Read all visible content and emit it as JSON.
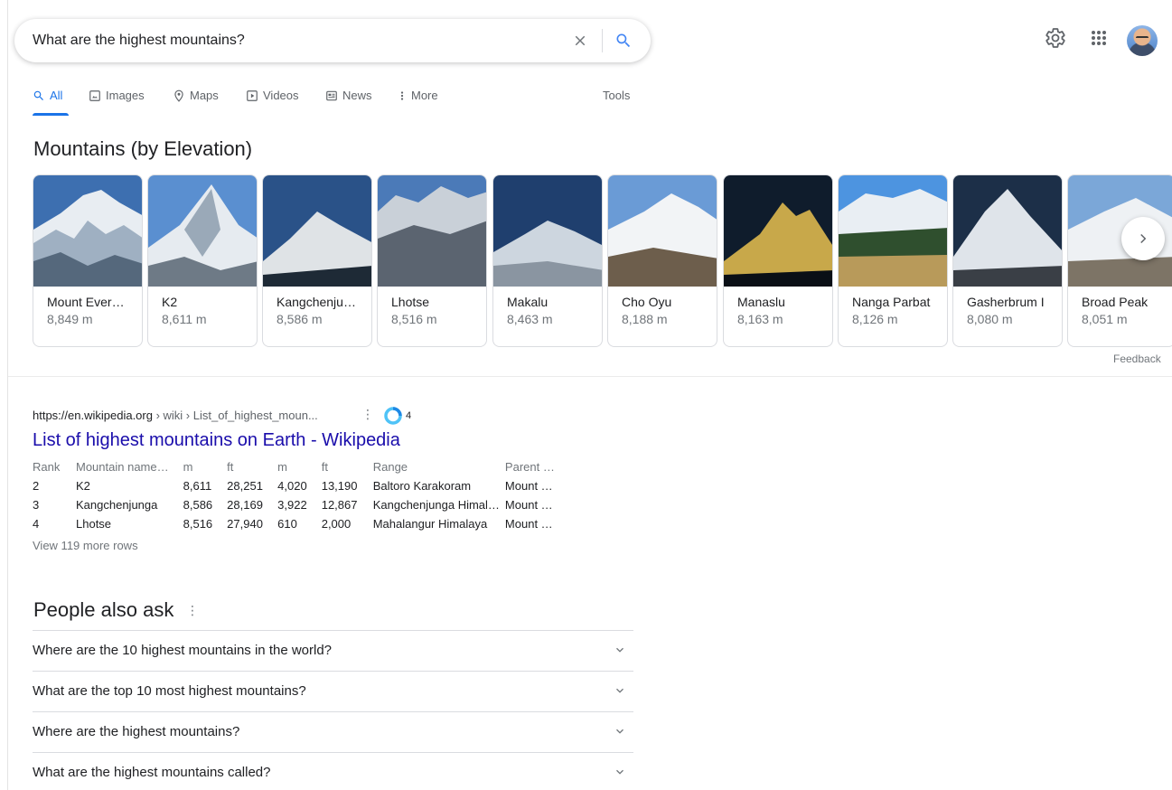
{
  "search": {
    "query": "What are the highest mountains?"
  },
  "icons": {
    "clear": "close-icon",
    "search": "search-icon",
    "settings": "gear-icon",
    "apps": "apps-grid-icon",
    "account": "avatar"
  },
  "colors": {
    "link": "#1a0dab",
    "accent": "#1a73e8",
    "muted": "#70757a"
  },
  "tabs": [
    {
      "label": "All",
      "icon": "search-icon",
      "active": true
    },
    {
      "label": "Images",
      "icon": "image-icon"
    },
    {
      "label": "Maps",
      "icon": "map-pin-icon"
    },
    {
      "label": "Videos",
      "icon": "video-icon"
    },
    {
      "label": "News",
      "icon": "news-icon"
    },
    {
      "label": "More",
      "icon": "more-vert-icon"
    }
  ],
  "tools_label": "Tools",
  "carousel": {
    "title": "Mountains (by Elevation)",
    "items": [
      {
        "name": "Mount Ever…",
        "elevation": "8,849 m"
      },
      {
        "name": "K2",
        "elevation": "8,611 m"
      },
      {
        "name": "Kangchenju…",
        "elevation": "8,586 m"
      },
      {
        "name": "Lhotse",
        "elevation": "8,516 m"
      },
      {
        "name": "Makalu",
        "elevation": "8,463 m"
      },
      {
        "name": "Cho Oyu",
        "elevation": "8,188 m"
      },
      {
        "name": "Manaslu",
        "elevation": "8,163 m"
      },
      {
        "name": "Nanga Parbat",
        "elevation": "8,126 m"
      },
      {
        "name": "Gasherbrum I",
        "elevation": "8,080 m"
      },
      {
        "name": "Broad Peak",
        "elevation": "8,051 m"
      }
    ],
    "feedback": "Feedback"
  },
  "result": {
    "domain": "https://en.wikipedia.org",
    "path": " › wiki › List_of_highest_moun...",
    "ring_count": "4",
    "title": "List of highest mountains on Earth - Wikipedia",
    "table": {
      "headers": [
        "Rank",
        "Mountain name…",
        "m",
        "ft",
        "m",
        "ft",
        "Range",
        "Parent …"
      ],
      "rows": [
        [
          "2",
          "K2",
          "8,611",
          "28,251",
          "4,020",
          "13,190",
          "Baltoro Karakoram",
          "Mount …"
        ],
        [
          "3",
          "Kangchenjunga",
          "8,586",
          "28,169",
          "3,922",
          "12,867",
          "Kangchenjunga Himal…",
          "Mount …"
        ],
        [
          "4",
          "Lhotse",
          "8,516",
          "27,940",
          "610",
          "2,000",
          "Mahalangur Himalaya",
          "Mount …"
        ]
      ]
    },
    "more_rows": "View 119 more rows"
  },
  "people_also_ask": {
    "title": "People also ask",
    "questions": [
      "Where are the 10 highest mountains in the world?",
      "What are the top 10 most highest mountains?",
      "Where are the highest mountains?",
      "What are the highest mountains called?"
    ]
  }
}
